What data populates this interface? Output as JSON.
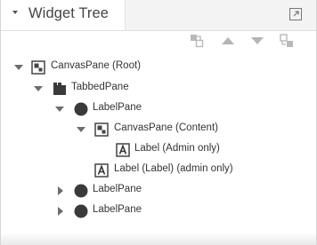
{
  "panel": {
    "title": "Widget Tree"
  },
  "toolbar": {
    "buttons": [
      {
        "icon": "expand-all-icon"
      },
      {
        "icon": "move-up-icon"
      },
      {
        "icon": "move-down-icon"
      },
      {
        "icon": "collapse-all-icon"
      }
    ]
  },
  "tree": {
    "nodes": [
      {
        "label": "CanvasPane (Root)",
        "icon": "canvas-pane-icon",
        "expanded": true
      },
      {
        "label": "TabbedPane",
        "icon": "tabbed-pane-icon",
        "expanded": true
      },
      {
        "label": "LabelPane",
        "icon": "label-pane-icon",
        "expanded": true
      },
      {
        "label": "CanvasPane (Content)",
        "icon": "canvas-pane-icon",
        "expanded": true
      },
      {
        "label": "Label (Admin only)",
        "icon": "label-icon"
      },
      {
        "label": "Label (Label) (admin only)",
        "icon": "label-icon"
      },
      {
        "label": "LabelPane",
        "icon": "label-pane-icon",
        "expanded": false
      },
      {
        "label": "LabelPane",
        "icon": "label-pane-icon",
        "expanded": false
      }
    ]
  },
  "colors": {
    "icon_dark": "#3a3a3a",
    "icon_muted": "#b5b5b5",
    "text": "#333333"
  }
}
